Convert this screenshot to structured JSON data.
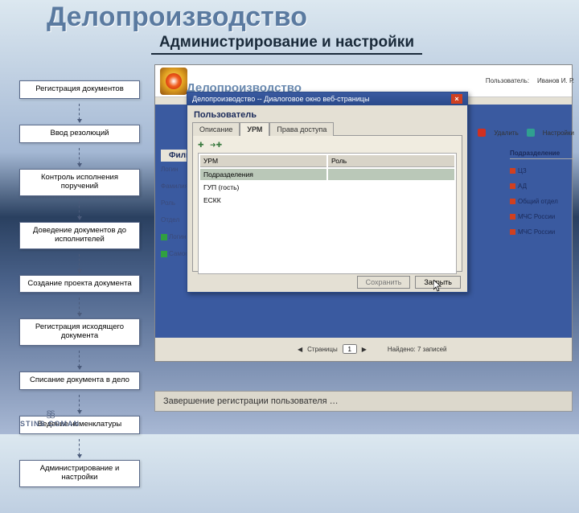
{
  "title": "Делопроизводство",
  "subtitle": "Администрирование и настройки",
  "sidebar": {
    "items": [
      {
        "label": "Регистрация документов"
      },
      {
        "label": "Ввод резолюций"
      },
      {
        "label": "Контроль исполнения поручений"
      },
      {
        "label": "Доведение документов до исполнителей"
      },
      {
        "label": "Создание проекта документа"
      },
      {
        "label": "Регистрация исходящего документа"
      },
      {
        "label": "Списание документа в дело"
      },
      {
        "label": "Ведение номенклатуры"
      },
      {
        "label": "Администрирование и настройки"
      }
    ]
  },
  "logo": {
    "text": "STINS COMAN"
  },
  "app": {
    "ghost_title": "Делопроизводство",
    "user_label": "Пользователь:",
    "user_name": "Иванов И. Р.",
    "tb_delete": "Удалить",
    "tb_settings": "Настройки"
  },
  "filter": {
    "header": "Фильтр",
    "fields": [
      "Логин",
      "Фамилия",
      "Роль",
      "Отдел"
    ],
    "chk1": "Логин",
    "chk2": "Самост"
  },
  "podraz": {
    "header": "Подразделение",
    "items": [
      "ЦЗ",
      "АД",
      "Общий отдел",
      "МЧС России",
      "МЧС России"
    ]
  },
  "dialog": {
    "title": "Делопроизводство -- Диалоговое окно веб-страницы",
    "section": "Пользователь",
    "tabs": [
      "Описание",
      "УРМ",
      "Права доступа"
    ],
    "active_tab": 1,
    "col1": "УРМ",
    "col2": "Роль",
    "rows": [
      "Подразделения",
      "ГУП (гость)",
      "ЕСКК"
    ],
    "btn_save": "Сохранить",
    "btn_close": "Закрыть"
  },
  "pager": {
    "label": "Страницы",
    "page": "1",
    "found": "Найдено: 7 записей"
  },
  "footer": {
    "text": "Завершение регистрации пользователя …"
  }
}
